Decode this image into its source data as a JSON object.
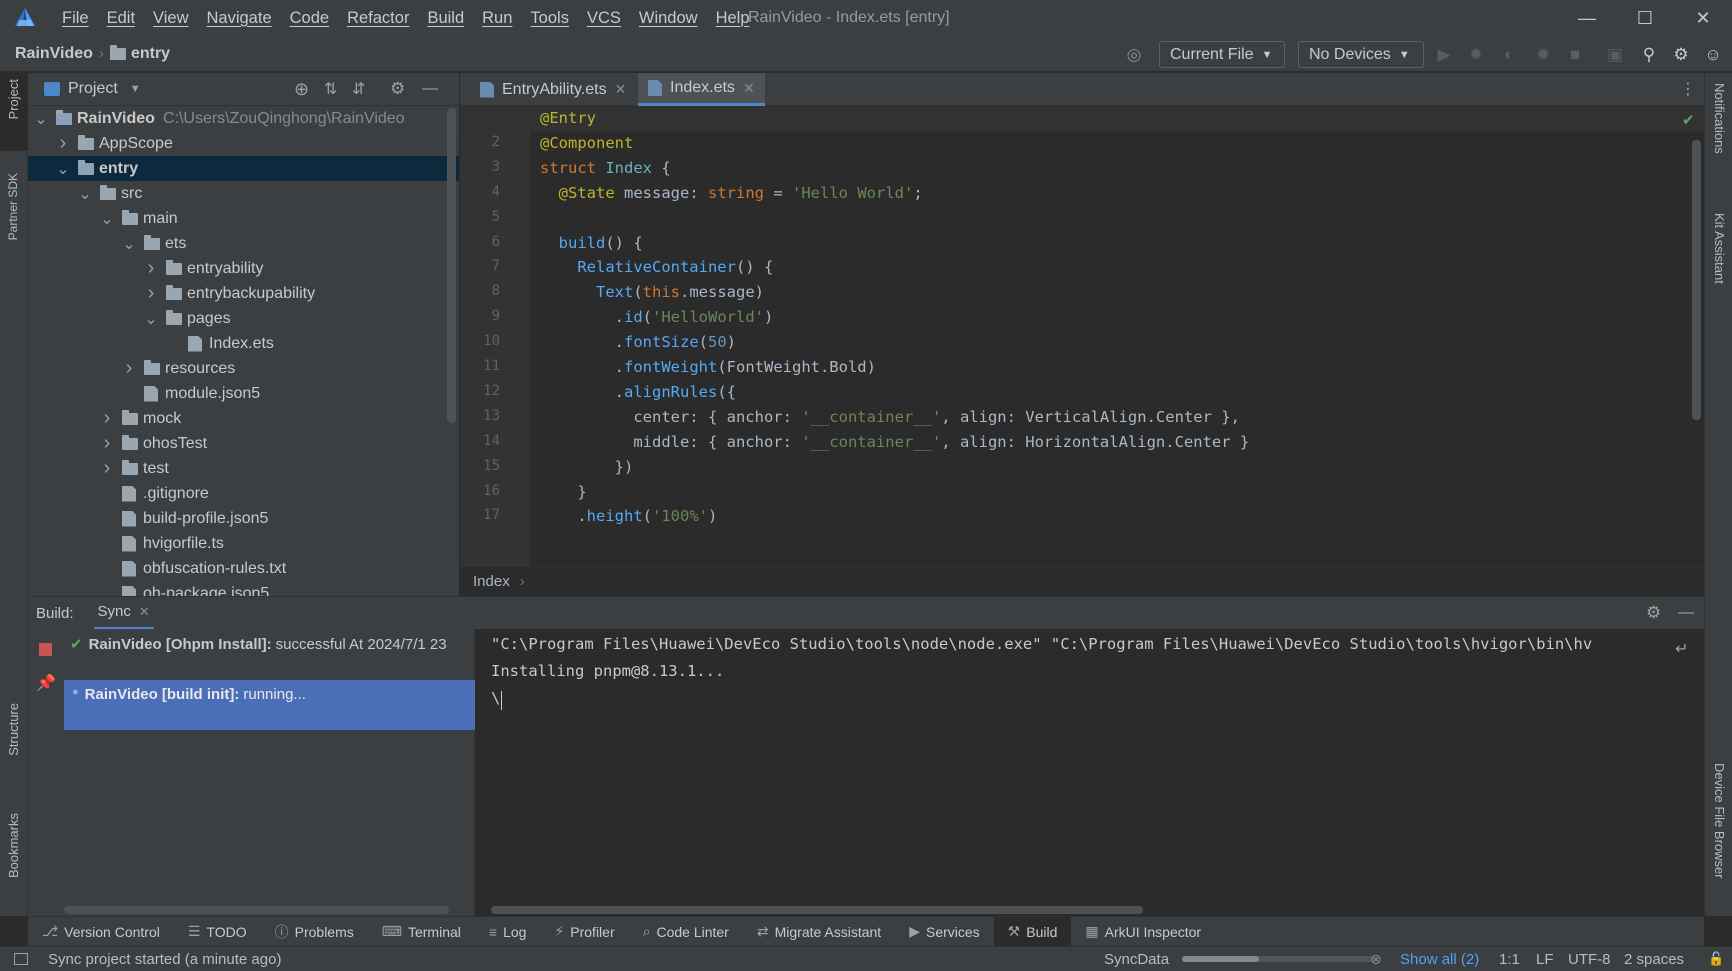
{
  "window": {
    "title": "RainVideo - Index.ets [entry]"
  },
  "menu": [
    "File",
    "Edit",
    "View",
    "Navigate",
    "Code",
    "Refactor",
    "Build",
    "Run",
    "Tools",
    "VCS",
    "Window",
    "Help"
  ],
  "navbar": {
    "project": "RainVideo",
    "module": "entry",
    "config": "Current File",
    "devices": "No Devices"
  },
  "project_panel": {
    "title": "Project",
    "tree": [
      {
        "label": "RainVideo",
        "path": "C:\\Users\\ZouQinghong\\RainVideo",
        "depth": 0,
        "expanded": true,
        "type": "module",
        "bold": true
      },
      {
        "label": "AppScope",
        "depth": 1,
        "expanded": false,
        "type": "folder"
      },
      {
        "label": "entry",
        "depth": 1,
        "expanded": true,
        "type": "module",
        "bold": true,
        "selected": true
      },
      {
        "label": "src",
        "depth": 2,
        "expanded": true,
        "type": "folder"
      },
      {
        "label": "main",
        "depth": 3,
        "expanded": true,
        "type": "folder"
      },
      {
        "label": "ets",
        "depth": 4,
        "expanded": true,
        "type": "folder"
      },
      {
        "label": "entryability",
        "depth": 5,
        "expanded": false,
        "type": "folder"
      },
      {
        "label": "entrybackupability",
        "depth": 5,
        "expanded": false,
        "type": "folder"
      },
      {
        "label": "pages",
        "depth": 5,
        "expanded": true,
        "type": "folder"
      },
      {
        "label": "Index.ets",
        "depth": 6,
        "type": "file"
      },
      {
        "label": "resources",
        "depth": 4,
        "expanded": false,
        "type": "folder"
      },
      {
        "label": "module.json5",
        "depth": 4,
        "type": "file"
      },
      {
        "label": "mock",
        "depth": 3,
        "expanded": false,
        "type": "folder"
      },
      {
        "label": "ohosTest",
        "depth": 3,
        "expanded": false,
        "type": "folder"
      },
      {
        "label": "test",
        "depth": 3,
        "expanded": false,
        "type": "folder"
      },
      {
        "label": ".gitignore",
        "depth": 3,
        "type": "file"
      },
      {
        "label": "build-profile.json5",
        "depth": 3,
        "type": "file"
      },
      {
        "label": "hvigorfile.ts",
        "depth": 3,
        "type": "file"
      },
      {
        "label": "obfuscation-rules.txt",
        "depth": 3,
        "type": "file"
      },
      {
        "label": "oh-package.json5",
        "depth": 3,
        "type": "file"
      }
    ]
  },
  "editor": {
    "tabs": [
      {
        "label": "EntryAbility.ets",
        "active": false
      },
      {
        "label": "Index.ets",
        "active": true
      }
    ],
    "breadcrumb": "Index",
    "lines": [
      [
        [
          "an",
          "@Entry"
        ]
      ],
      [
        [
          "an",
          "@Component"
        ]
      ],
      [
        [
          "kw",
          "struct "
        ],
        [
          "ty",
          "Index "
        ],
        [
          "pl",
          "{"
        ]
      ],
      [
        [
          "pl",
          "  "
        ],
        [
          "an",
          "@State "
        ],
        [
          "pl",
          "message: "
        ],
        [
          "kw",
          "string "
        ],
        [
          "pl",
          "= "
        ],
        [
          "st",
          "'Hello World'"
        ],
        [
          "pl",
          ";"
        ]
      ],
      [
        [
          "pl",
          ""
        ]
      ],
      [
        [
          "pl",
          "  "
        ],
        [
          "fn",
          "build"
        ],
        [
          "pl",
          "() {"
        ]
      ],
      [
        [
          "pl",
          "    "
        ],
        [
          "fn",
          "RelativeContainer"
        ],
        [
          "pl",
          "() {"
        ]
      ],
      [
        [
          "pl",
          "      "
        ],
        [
          "fn",
          "Text"
        ],
        [
          "pl",
          "("
        ],
        [
          "kw",
          "this"
        ],
        [
          "pl",
          ".message)"
        ]
      ],
      [
        [
          "pl",
          "        ."
        ],
        [
          "fn",
          "id"
        ],
        [
          "pl",
          "("
        ],
        [
          "st",
          "'HelloWorld'"
        ],
        [
          "pl",
          ")"
        ]
      ],
      [
        [
          "pl",
          "        ."
        ],
        [
          "fn",
          "fontSize"
        ],
        [
          "pl",
          "("
        ],
        [
          "nm",
          "50"
        ],
        [
          "pl",
          ")"
        ]
      ],
      [
        [
          "pl",
          "        ."
        ],
        [
          "fn",
          "fontWeight"
        ],
        [
          "pl",
          "(FontWeight.Bold)"
        ]
      ],
      [
        [
          "pl",
          "        ."
        ],
        [
          "fn",
          "alignRules"
        ],
        [
          "pl",
          "({"
        ]
      ],
      [
        [
          "pl",
          "          center: { anchor: "
        ],
        [
          "st",
          "'__container__'"
        ],
        [
          "pl",
          ", align: VerticalAlign.Center },"
        ]
      ],
      [
        [
          "pl",
          "          middle: { anchor: "
        ],
        [
          "st",
          "'__container__'"
        ],
        [
          "pl",
          ", align: HorizontalAlign.Center }"
        ]
      ],
      [
        [
          "pl",
          "        })"
        ]
      ],
      [
        [
          "pl",
          "    }"
        ]
      ],
      [
        [
          "pl",
          "    ."
        ],
        [
          "fn",
          "height"
        ],
        [
          "pl",
          "("
        ],
        [
          "st",
          "'100%'"
        ],
        [
          "pl",
          ")"
        ]
      ]
    ]
  },
  "build": {
    "label": "Build:",
    "tab": "Sync",
    "items": [
      {
        "name": "RainVideo [Ohpm Install]:",
        "status": "successful At 2024/7/1 23"
      },
      {
        "name": "RainVideo [build init]:",
        "status": "running..."
      }
    ],
    "console": [
      "\"C:\\Program Files\\Huawei\\DevEco Studio\\tools\\node\\node.exe\" \"C:\\Program Files\\Huawei\\DevEco Studio\\tools\\hvigor\\bin\\hv",
      "Installing pnpm@8.13.1...",
      "\\"
    ]
  },
  "tool_windows": [
    "Version Control",
    "TODO",
    "Problems",
    "Terminal",
    "Log",
    "Profiler",
    "Code Linter",
    "Migrate Assistant",
    "Services",
    "Build",
    "ArkUI Inspector"
  ],
  "left_strip": [
    "Project",
    "Partner SDK",
    "Structure",
    "Bookmarks"
  ],
  "right_strip": [
    "Notifications",
    "Kit Assistant",
    "Device File Browser"
  ],
  "status": {
    "message": "Sync project started (a minute ago)",
    "task": "SyncData",
    "show_all": "Show all (2)",
    "position": "1:1",
    "line_sep": "LF",
    "encoding": "UTF-8",
    "indent": "2 spaces"
  },
  "colors": {
    "accent": "#4a88c7",
    "selection": "#0d293e",
    "bg": "#2b2b2b",
    "panel": "#3c3f41"
  }
}
